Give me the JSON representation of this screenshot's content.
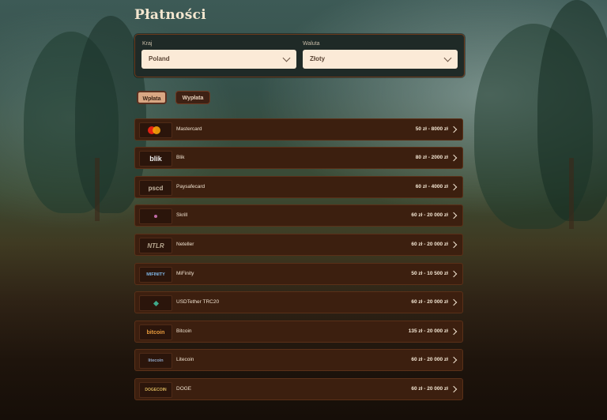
{
  "page_title": "Płatności",
  "filters": {
    "country_label": "Kraj",
    "country_value": "Poland",
    "currency_label": "Waluta",
    "currency_value": "Złoty"
  },
  "tabs": [
    {
      "label": "Wpłata",
      "active": true
    },
    {
      "label": "Wypłata",
      "active": false
    }
  ],
  "methods": [
    {
      "name": "Mastercard",
      "range": "50 zł - 8000 zł",
      "logo": "mastercard-logo",
      "logo_text": ""
    },
    {
      "name": "Blik",
      "range": "80 zł - 2000 zł",
      "logo": "blik-logo",
      "logo_text": "blik"
    },
    {
      "name": "Paysafecard",
      "range": "60 zł - 4000 zł",
      "logo": "paysafecard-logo",
      "logo_text": "pscd"
    },
    {
      "name": "Skrill",
      "range": "60 zł - 20 000 zł",
      "logo": "skrill-logo",
      "logo_text": ""
    },
    {
      "name": "Neteller",
      "range": "60 zł - 20 000 zł",
      "logo": "neteller-logo",
      "logo_text": "NTLR"
    },
    {
      "name": "MiFinity",
      "range": "50 zł - 10 500 zł",
      "logo": "mifinity-logo",
      "logo_text": "MIFINITY"
    },
    {
      "name": "USDTether TRC20",
      "range": "60 zł - 20 000 zł",
      "logo": "tether-logo",
      "logo_text": ""
    },
    {
      "name": "Bitcoin",
      "range": "135 zł - 20 000 zł",
      "logo": "bitcoin-logo",
      "logo_text": "bitcoin"
    },
    {
      "name": "Litecoin",
      "range": "60 zł - 20 000 zł",
      "logo": "litecoin-logo",
      "logo_text": "litecoin"
    },
    {
      "name": "DOGE",
      "range": "60 zł - 20 000 zł",
      "logo": "dogecoin-logo",
      "logo_text": "DOGECOIN"
    }
  ],
  "colors": {
    "row_bg": "#3c1f0f",
    "accent": "#d9a783",
    "text_light": "#f3e6d3"
  }
}
